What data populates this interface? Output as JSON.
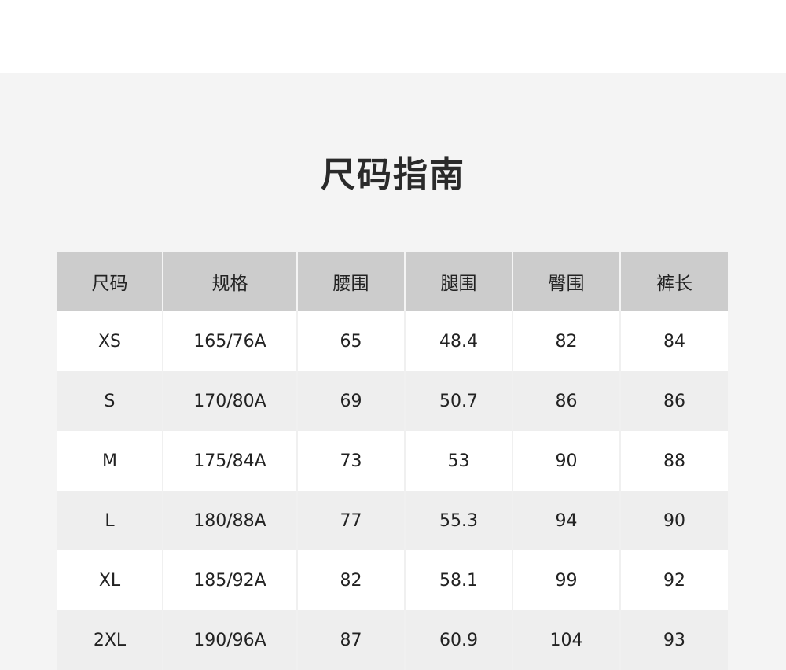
{
  "title": "尺码指南",
  "table": {
    "headers": [
      "尺码",
      "规格",
      "腰围",
      "腿围",
      "臀围",
      "裤长"
    ],
    "rows": [
      [
        "XS",
        "165/76A",
        "65",
        "48.4",
        "82",
        "84"
      ],
      [
        "S",
        "170/80A",
        "69",
        "50.7",
        "86",
        "86"
      ],
      [
        "M",
        "175/84A",
        "73",
        "53",
        "90",
        "88"
      ],
      [
        "L",
        "180/88A",
        "77",
        "55.3",
        "94",
        "90"
      ],
      [
        "XL",
        "185/92A",
        "82",
        "58.1",
        "99",
        "92"
      ],
      [
        "2XL",
        "190/96A",
        "87",
        "60.9",
        "104",
        "93"
      ]
    ]
  },
  "colors": {
    "panel_bg": "#f4f4f4",
    "header_bg": "#cccccc",
    "row_odd": "#ffffff",
    "row_even": "#eeeeee",
    "text": "#222222"
  }
}
